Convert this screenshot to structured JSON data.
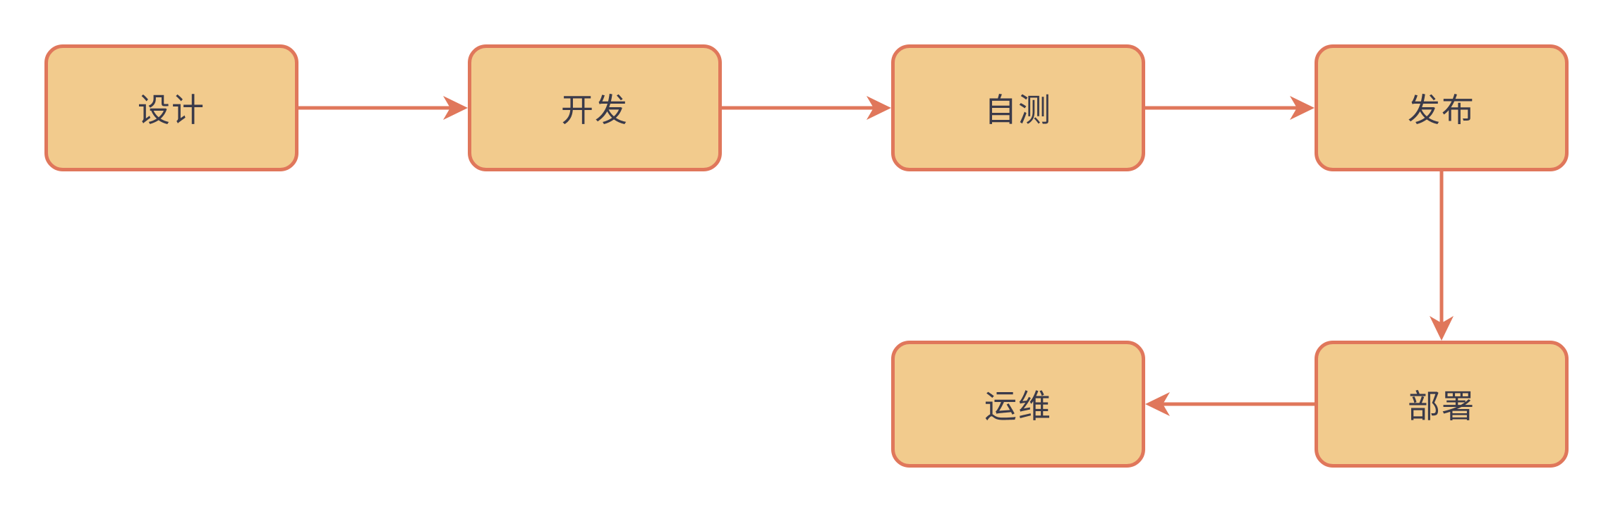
{
  "colors": {
    "node_fill": "#F2CB8D",
    "node_border": "#E0775B",
    "edge": "#E0775B",
    "text": "#3a3a4a"
  },
  "nodes": {
    "design": "设计",
    "develop": "开发",
    "selftest": "自测",
    "release": "发布",
    "deploy": "部署",
    "ops": "运维"
  },
  "edges": [
    {
      "from": "design",
      "to": "develop"
    },
    {
      "from": "develop",
      "to": "selftest"
    },
    {
      "from": "selftest",
      "to": "release"
    },
    {
      "from": "release",
      "to": "deploy"
    },
    {
      "from": "deploy",
      "to": "ops"
    }
  ]
}
